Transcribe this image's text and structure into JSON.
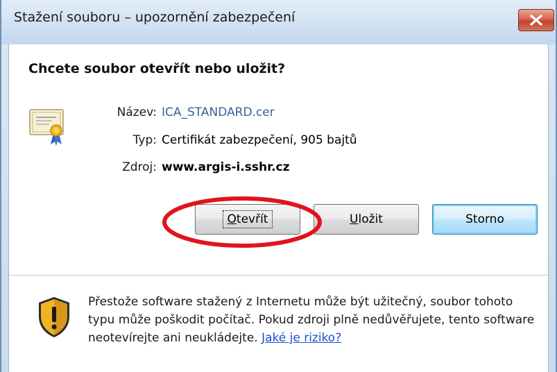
{
  "window": {
    "title": "Stažení souboru – upozornění zabezpečení",
    "close_icon": "close-icon"
  },
  "dialog": {
    "question": "Chcete soubor otevřít nebo uložit?",
    "file_icon": "certificate-icon",
    "fields": {
      "name_label": "Název:",
      "name_value": "ICA_STANDARD.cer",
      "type_label": "Typ:",
      "type_value": "Certifikát zabezpečení, 905 bajtů",
      "source_label": "Zdroj:",
      "source_value": "www.argis-i.sshr.cz"
    },
    "buttons": {
      "open_accel": "O",
      "open_rest": "tevřít",
      "save_accel": "U",
      "save_rest": "ložit",
      "cancel": "Storno"
    }
  },
  "footer": {
    "warning_icon": "shield-warning-icon",
    "warning_text": "Přestože software stažený z Internetu může být užitečný, soubor tohoto typu může poškodit počítač. Pokud zdroji plně nedůvěřujete, tento software neotevírejte ani neukládejte.",
    "risk_link": "Jaké je riziko?"
  },
  "colors": {
    "link": "#1c4fcf",
    "highlight_ellipse": "#e0141e",
    "close_button": "#c2432d"
  }
}
